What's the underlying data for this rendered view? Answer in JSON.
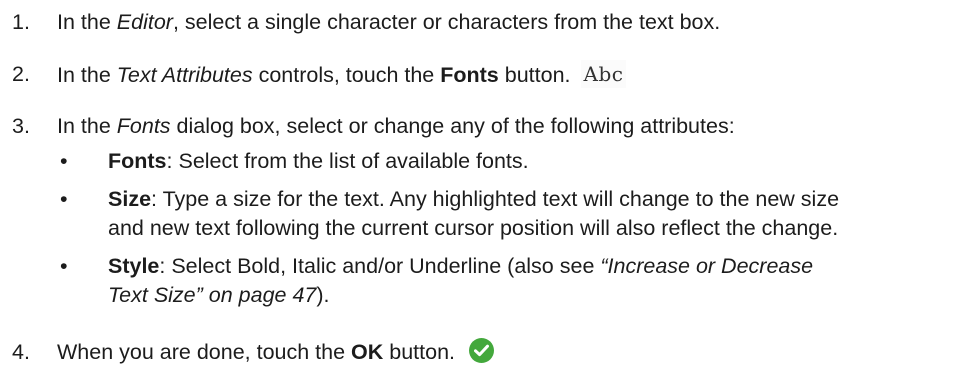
{
  "steps": [
    {
      "number": "1.",
      "parts": [
        "In the ",
        "Editor",
        ", select a single character or characters from the text box."
      ]
    },
    {
      "number": "2.",
      "parts": [
        "In the ",
        "Text Attributes",
        " controls, touch the ",
        "Fonts",
        " button."
      ],
      "icon_text": "Abc"
    },
    {
      "number": "3.",
      "parts": [
        "In the ",
        "Fonts",
        " dialog box, select or change any of the following attributes:"
      ],
      "bullets": [
        {
          "symbol": "•",
          "term": "Fonts",
          "text": ": Select from the list of available fonts."
        },
        {
          "symbol": "•",
          "term": "Size",
          "text": ": Type a size for the text. Any highlighted text will change to the new size",
          "text2": "and new text following the current cursor position will also reflect the change."
        },
        {
          "symbol": "•",
          "term": "Style",
          "text": ": Select Bold, Italic and/or Underline (also see ",
          "link1": "“Increase or Decrease",
          "link2": "Text Size” on page 47",
          "text_end": ")."
        }
      ]
    },
    {
      "number": "4.",
      "parts": [
        "When you are done, touch the ",
        "OK",
        " button."
      ]
    }
  ],
  "icons": {
    "fonts_button": "abc-fonts-icon",
    "ok_button": "green-checkmark-icon",
    "ok_color": "#43a83c"
  }
}
